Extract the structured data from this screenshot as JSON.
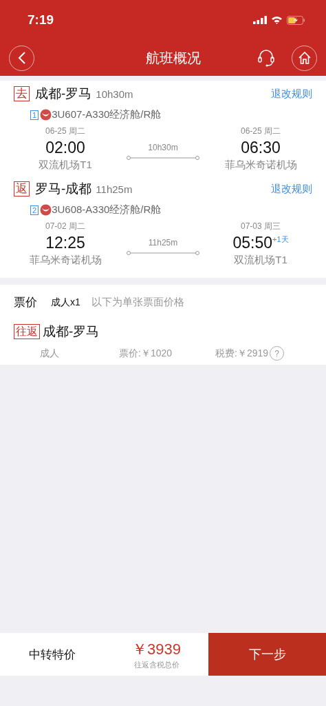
{
  "status_bar": {
    "time": "7:19"
  },
  "nav": {
    "title": "航班概况"
  },
  "segments": [
    {
      "badge": "去",
      "route": "成都-罗马",
      "duration": "10h30m",
      "rules_link": "退改规则",
      "index": "1",
      "flight": "3U607-A330经济舱/R舱",
      "departure": {
        "date": "06-25 周二",
        "time": "02:00",
        "airport": "双流机场T1"
      },
      "arrival": {
        "date": "06-25 周二",
        "time": "06:30",
        "airport": "菲乌米奇诺机场"
      },
      "flight_duration": "10h30m"
    },
    {
      "badge": "返",
      "route": "罗马-成都",
      "duration": "11h25m",
      "rules_link": "退改规则",
      "index": "2",
      "flight": "3U608-A330经济舱/R舱",
      "departure": {
        "date": "07-02 周二",
        "time": "12:25",
        "airport": "菲乌米奇诺机场"
      },
      "arrival": {
        "date": "07-03 周三",
        "time": "05:50",
        "airport": "双流机场T1",
        "day_offset": "+1天"
      },
      "flight_duration": "11h25m"
    }
  ],
  "fare": {
    "title": "票价",
    "passengers": "成人x1",
    "note": "以下为单张票面价格",
    "badge": "往返",
    "route": "成都-罗马",
    "passenger_type": "成人",
    "ticket_price": "票价:￥1020",
    "tax": "税费:￥2919",
    "help": "?"
  },
  "footer": {
    "label": "中转特价",
    "total": "￥3939",
    "total_note": "往返含税总价",
    "next_button": "下一步"
  }
}
